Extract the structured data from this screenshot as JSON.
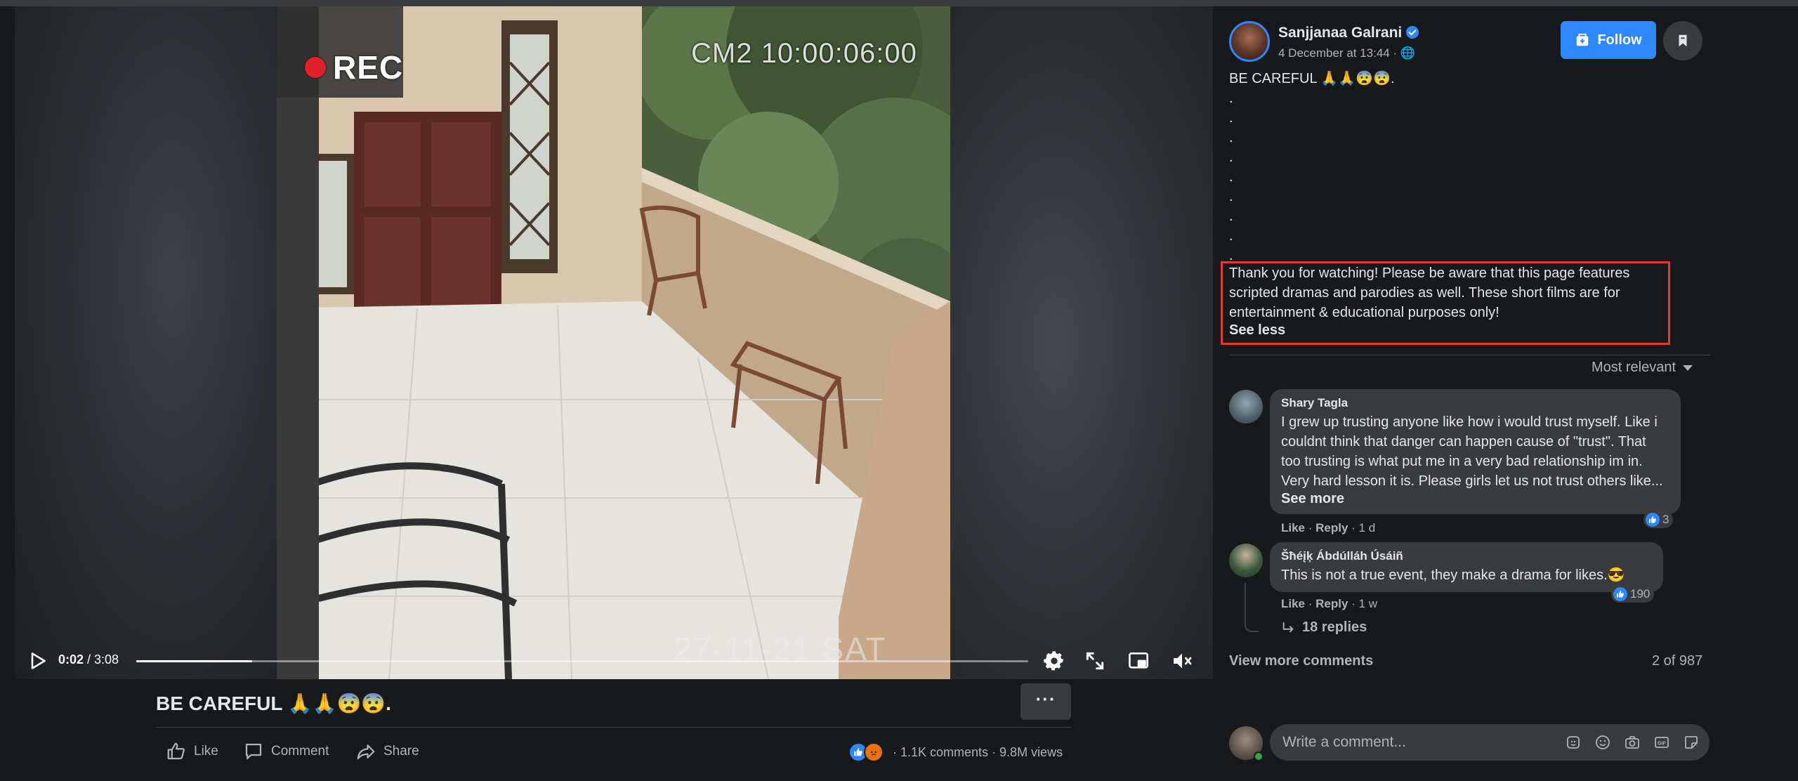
{
  "video": {
    "overlay": {
      "rec": "REC",
      "cam_time": "CM2 10:00:06:00",
      "cam_date": "27-11-21 SAT"
    },
    "current_time": "0:02",
    "duration": " / 3:08",
    "progress_fraction": 0.13
  },
  "post": {
    "title": "BE CAREFUL 🙏🙏😨😨.",
    "more_label": "···",
    "actions": {
      "like": "Like",
      "comment": "Comment",
      "share": "Share"
    },
    "stats": "· 1.1K comments · 9.8M views"
  },
  "author": {
    "name": "Sanjjanaa Galrani",
    "date": "4 December at 13:44 · 🌐",
    "follow_label": "Follow"
  },
  "caption": {
    "first_line": "BE CAREFUL 🙏🙏😨😨.",
    "dots": [
      ".",
      ".",
      ".",
      ".",
      ".",
      ".",
      ".",
      ".",
      "."
    ],
    "description": "Thank you for watching! Please be aware that this page features scripted dramas and parodies as well. These short films are for entertainment & educational purposes only!",
    "see_less": "See less"
  },
  "comments_section": {
    "sort_label": "Most relevant",
    "comments": [
      {
        "name": "Shary Tagla",
        "text": "I grew up trusting anyone like how i would trust myself. Like i couldnt think that danger can happen cause of \"trust\". That too trusting is what put me in a very bad relationship im in. Very hard lesson it is. Please girls let us not trust others like...",
        "see_more": "See more",
        "like": "Like",
        "reply": "Reply",
        "age": "· 1 d",
        "reactions": "3"
      },
      {
        "name": "Šħéįķ Ábdúlláh Úsáiñ",
        "text": "This is not a true event, they make a drama for likes.😎",
        "like": "Like",
        "reply": "Reply",
        "age": "· 1 w",
        "reactions": "190",
        "replies": "18 replies"
      }
    ],
    "view_more": "View more comments",
    "count": "2 of 987",
    "input_placeholder": "Write a comment..."
  },
  "colors": {
    "accent": "#2d88ff",
    "highlight_box": "#e03a2b",
    "background": "#18191a",
    "surface": "#3a3b3c"
  }
}
